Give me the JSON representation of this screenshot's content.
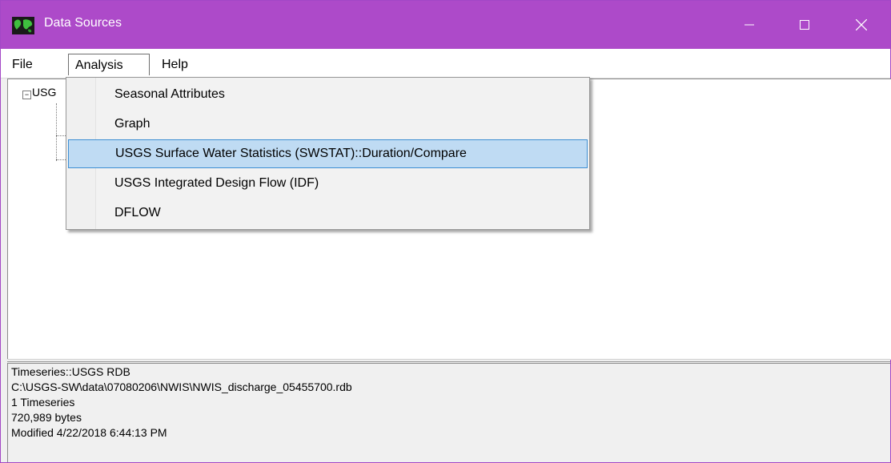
{
  "window": {
    "title": "Data Sources"
  },
  "menubar": {
    "file": "File",
    "analysis": "Analysis",
    "help": "Help"
  },
  "analysis_menu": {
    "items": [
      "Seasonal Attributes",
      "Graph",
      "USGS Surface Water Statistics (SWSTAT)::Duration/Compare",
      "USGS Integrated Design Flow (IDF)",
      "DFLOW"
    ],
    "highlighted": "USGS Surface Water Statistics (SWSTAT)::Duration/Compare"
  },
  "tree": {
    "root_label": "USG"
  },
  "info": {
    "lines": [
      "Timeseries::USGS RDB",
      "C:\\USGS-SW\\data\\07080206\\NWIS\\NWIS_discharge_05455700.rdb",
      "1 Timeseries",
      "720,989 bytes",
      "Modified 4/22/2018 6:44:13 PM"
    ]
  },
  "colors": {
    "titlebar": "#ad4ac9",
    "highlight": "#bfdbf3",
    "highlight_border": "#3c8ed3"
  },
  "icons": {
    "app": "world-map-icon",
    "minimize": "minimize-icon",
    "maximize": "maximize-icon",
    "close": "close-icon",
    "expander": "tree-collapse-icon"
  }
}
